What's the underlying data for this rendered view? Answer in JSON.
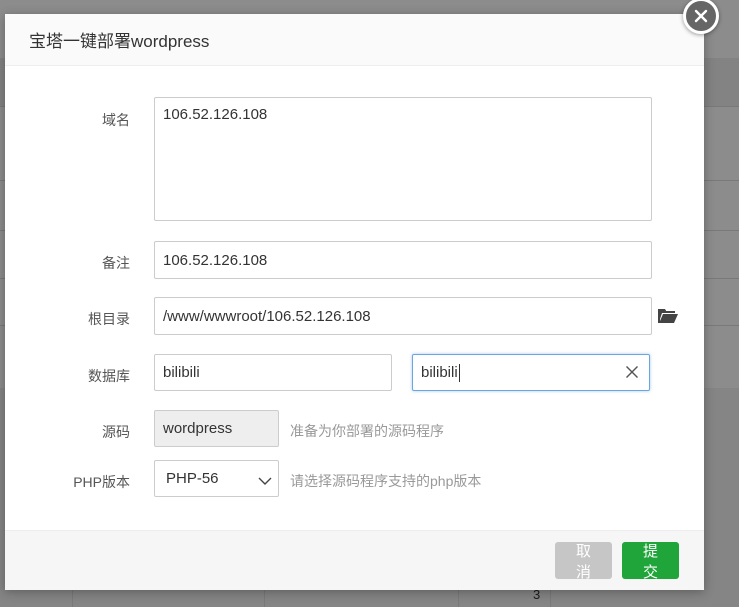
{
  "dialog": {
    "title": "宝塔一键部署wordpress"
  },
  "form": {
    "domain": {
      "label": "域名",
      "value": "106.52.126.108"
    },
    "remark": {
      "label": "备注",
      "value": "106.52.126.108"
    },
    "root_dir": {
      "label": "根目录",
      "value": "/www/wwwroot/106.52.126.108"
    },
    "database": {
      "label": "数据库",
      "name_value": "bilibili",
      "password_value": "bilibili"
    },
    "source": {
      "label": "源码",
      "value": "wordpress",
      "hint": "准备为你部署的源码程序"
    },
    "php": {
      "label": "PHP版本",
      "selected": "PHP-56",
      "hint": "请选择源码程序支持的php版本"
    }
  },
  "footer": {
    "cancel_label": "取消",
    "submit_label": "提交"
  },
  "background": {
    "axis_tick": "3"
  },
  "colors": {
    "submit": "#20a53a",
    "cancel": "#c6c6c6",
    "focus_border": "#6aa7e0"
  }
}
